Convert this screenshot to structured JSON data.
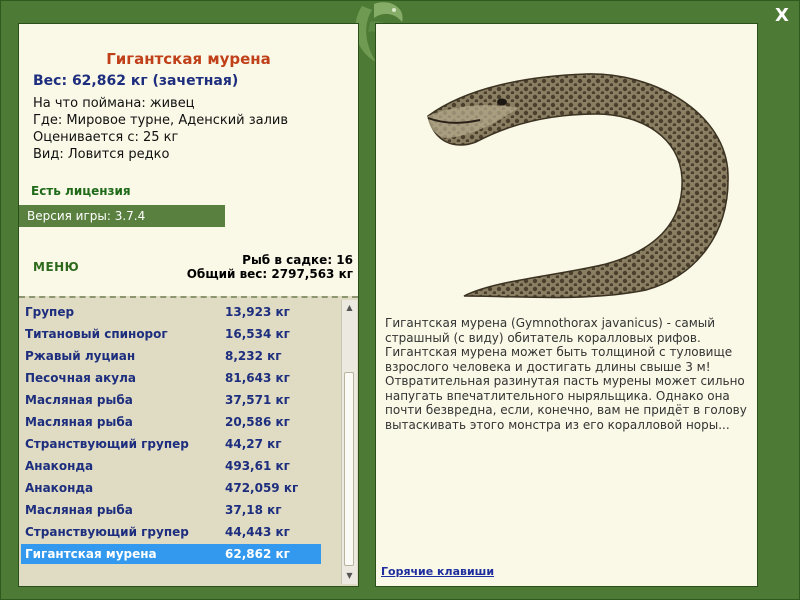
{
  "fish": {
    "name": "Гигантская мурена",
    "weight": "Вес: 62,862 кг (зачетная)",
    "caught_with": "На что поймана: живец",
    "location": "Где: Мировое турне, Аденский залив",
    "valued_from": "Оценивается с: 25 кг",
    "species": "Вид: Ловится редко",
    "description": "Гигантская мурена (Gymnothorax javanicus) - самый страшный (с виду) обитатель коралловых рифов. Гигантская мурена может быть толщиной с туловище взрослого человека и достигать длины свыше 3 м! Отвратительная разинутая пасть мурены может сильно напугать впечатлительного ныряльщика. Однако она почти безвредна, если, конечно, вам не придёт в голову вытаскивать этого монстра из его коралловой норы..."
  },
  "license": "Есть лицензия",
  "version": "Версия игры: 3.7.4",
  "menu_label": "МЕНЮ",
  "cage": {
    "count": "Рыб в садке: 16",
    "total_weight": "Общий вес: 2797,563 кг"
  },
  "catch_list": [
    {
      "name": "Групер",
      "weight": "13,923 кг"
    },
    {
      "name": "Титановый спинорог",
      "weight": "16,534 кг"
    },
    {
      "name": "Ржавый луциан",
      "weight": "8,232 кг"
    },
    {
      "name": "Песочная акула",
      "weight": "81,643 кг"
    },
    {
      "name": "Масляная рыба",
      "weight": "37,571 кг"
    },
    {
      "name": "Масляная рыба",
      "weight": "20,586 кг"
    },
    {
      "name": "Странствующий групер",
      "weight": "44,27 кг"
    },
    {
      "name": "Анаконда",
      "weight": "493,61 кг"
    },
    {
      "name": "Анаконда",
      "weight": "472,059 кг"
    },
    {
      "name": "Масляная рыба",
      "weight": "37,18 кг"
    },
    {
      "name": "Странствующий групер",
      "weight": "44,443 кг"
    },
    {
      "name": "Гигантская мурена",
      "weight": "62,862 кг",
      "selected": true
    }
  ],
  "hotkeys_label": "Горячие клавиши",
  "close_label": "X",
  "icons": {
    "close": "close-icon",
    "logo": "leaf-logo-icon",
    "scroll_up": "scroll-up-icon",
    "scroll_down": "scroll-down-icon"
  },
  "colors": {
    "frame": "#4d7a34",
    "panel": "#faf8e6",
    "list_bg": "#dfdcc3",
    "title": "#c0401a",
    "accent": "#1e2e7e",
    "selection": "#3399ee"
  }
}
